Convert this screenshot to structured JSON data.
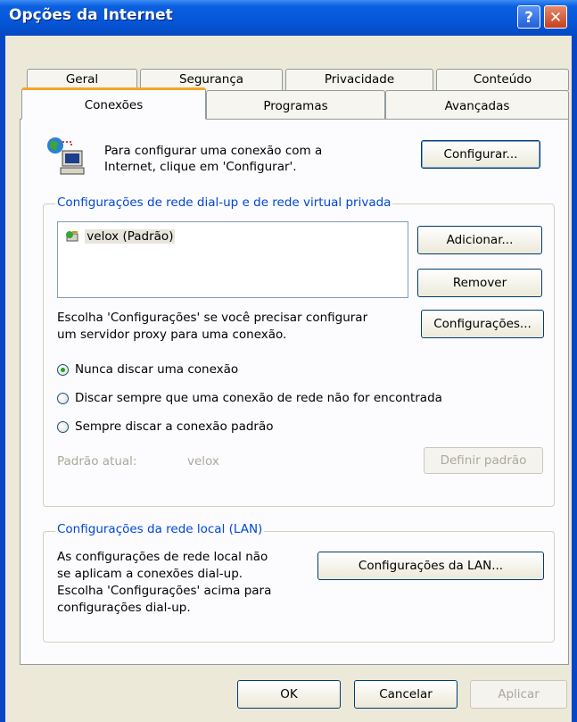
{
  "window": {
    "title": "Opções da Internet",
    "help_glyph": "?",
    "close_glyph": "✕"
  },
  "tabs_row1": [
    {
      "label": "Geral"
    },
    {
      "label": "Segurança"
    },
    {
      "label": "Privacidade"
    },
    {
      "label": "Conteúdo"
    }
  ],
  "tabs_row2": [
    {
      "label": "Conexões"
    },
    {
      "label": "Programas"
    },
    {
      "label": "Avançadas"
    }
  ],
  "intro": {
    "text_line1": "Para configurar uma conexão com a",
    "text_line2": "Internet, clique em 'Configurar'.",
    "setup_button": "Configurar..."
  },
  "dialup": {
    "legend": "Configurações de rede dial-up e de rede virtual privada",
    "connections": [
      {
        "name": "velox (Padrão)"
      }
    ],
    "add_button": "Adicionar...",
    "remove_button": "Remover",
    "proxy_text_line1": "Escolha 'Configurações' se você precisar configurar",
    "proxy_text_line2": "um servidor proxy para uma conexão.",
    "settings_button": "Configurações...",
    "options": [
      {
        "label": "Nunca discar uma conexão",
        "selected": true
      },
      {
        "label": "Discar sempre que uma conexão de rede não for encontrada",
        "selected": false
      },
      {
        "label": "Sempre discar a conexão padrão",
        "selected": false
      }
    ],
    "current_default_label": "Padrão atual:",
    "current_default_value": "velox",
    "set_default_button": "Definir padrão"
  },
  "lan": {
    "legend": "Configurações da rede local (LAN)",
    "text_lines": [
      "As configurações de rede local não",
      "se aplicam a conexões dial-up.",
      "Escolha 'Configurações' acima para",
      "configurações dial-up."
    ],
    "lan_button": "Configurações da LAN..."
  },
  "footer": {
    "ok": "OK",
    "cancel": "Cancelar",
    "apply": "Aplicar"
  },
  "colors": {
    "title_blue": "#0656d8",
    "accent_orange": "#f5a623",
    "legend_blue": "#0046d5",
    "face": "#ece9d8"
  }
}
